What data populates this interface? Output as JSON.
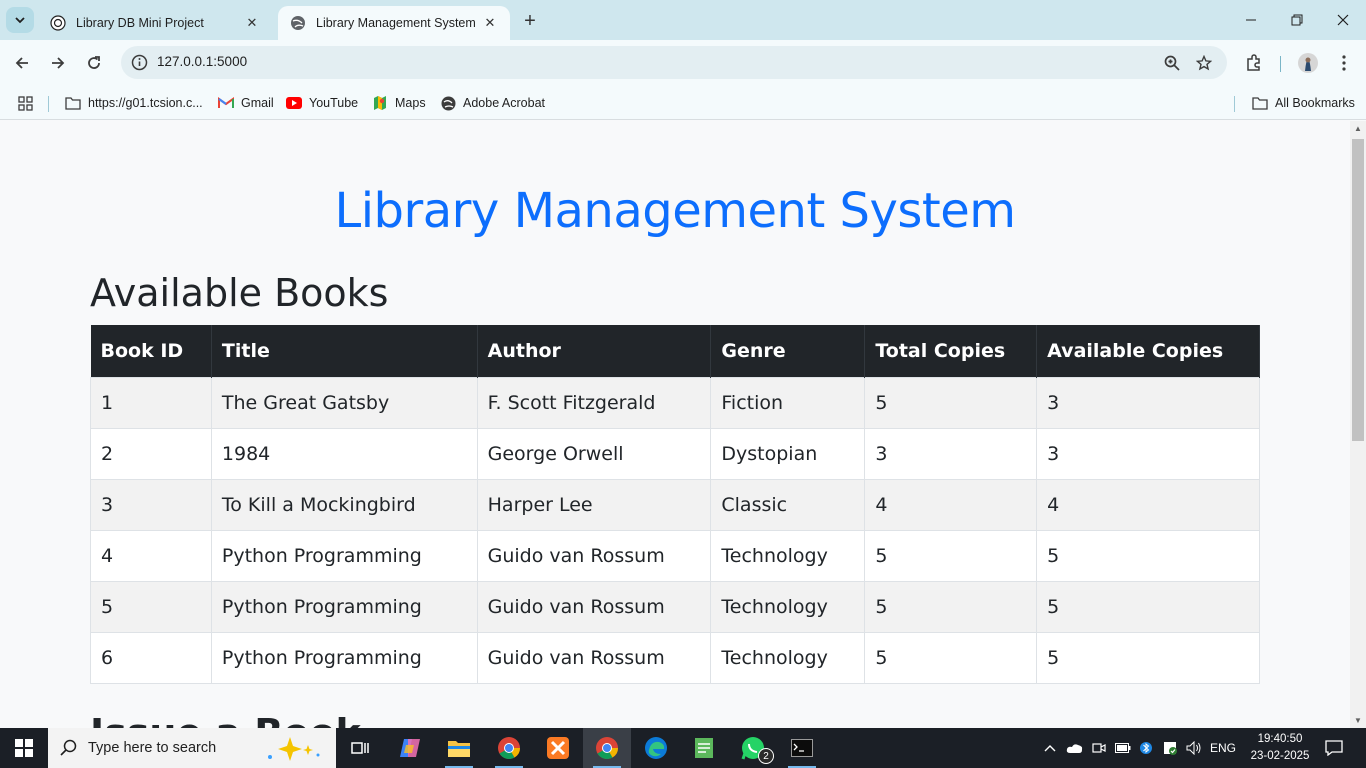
{
  "browser": {
    "tabs": [
      {
        "title": "Library DB Mini Project",
        "active": false
      },
      {
        "title": "Library Management System",
        "active": true
      }
    ],
    "url": "127.0.0.1:5000",
    "bookmarks": [
      {
        "label": "https://g01.tcsion.c...",
        "icon": "folder-icon"
      },
      {
        "label": "Gmail",
        "icon": "gmail-icon"
      },
      {
        "label": "YouTube",
        "icon": "youtube-icon"
      },
      {
        "label": "Maps",
        "icon": "maps-icon"
      },
      {
        "label": "Adobe Acrobat",
        "icon": "globe-icon"
      }
    ],
    "all_bookmarks": "All Bookmarks"
  },
  "page": {
    "title": "Library Management System",
    "section_title": "Available Books",
    "next_section_title": "Issue a Book",
    "table": {
      "headers": [
        "Book ID",
        "Title",
        "Author",
        "Genre",
        "Total Copies",
        "Available Copies"
      ],
      "rows": [
        [
          "1",
          "The Great Gatsby",
          "F. Scott Fitzgerald",
          "Fiction",
          "5",
          "3"
        ],
        [
          "2",
          "1984",
          "George Orwell",
          "Dystopian",
          "3",
          "3"
        ],
        [
          "3",
          "To Kill a Mockingbird",
          "Harper Lee",
          "Classic",
          "4",
          "4"
        ],
        [
          "4",
          "Python Programming",
          "Guido van Rossum",
          "Technology",
          "5",
          "5"
        ],
        [
          "5",
          "Python Programming",
          "Guido van Rossum",
          "Technology",
          "5",
          "5"
        ],
        [
          "6",
          "Python Programming",
          "Guido van Rossum",
          "Technology",
          "5",
          "5"
        ]
      ]
    },
    "colors": {
      "title": "#0d6efd",
      "table_header": "#212529"
    }
  },
  "taskbar": {
    "search_placeholder": "Type here to search",
    "language": "ENG",
    "time": "19:40:50",
    "date": "23-02-2025",
    "whatsapp_badge": "2"
  }
}
